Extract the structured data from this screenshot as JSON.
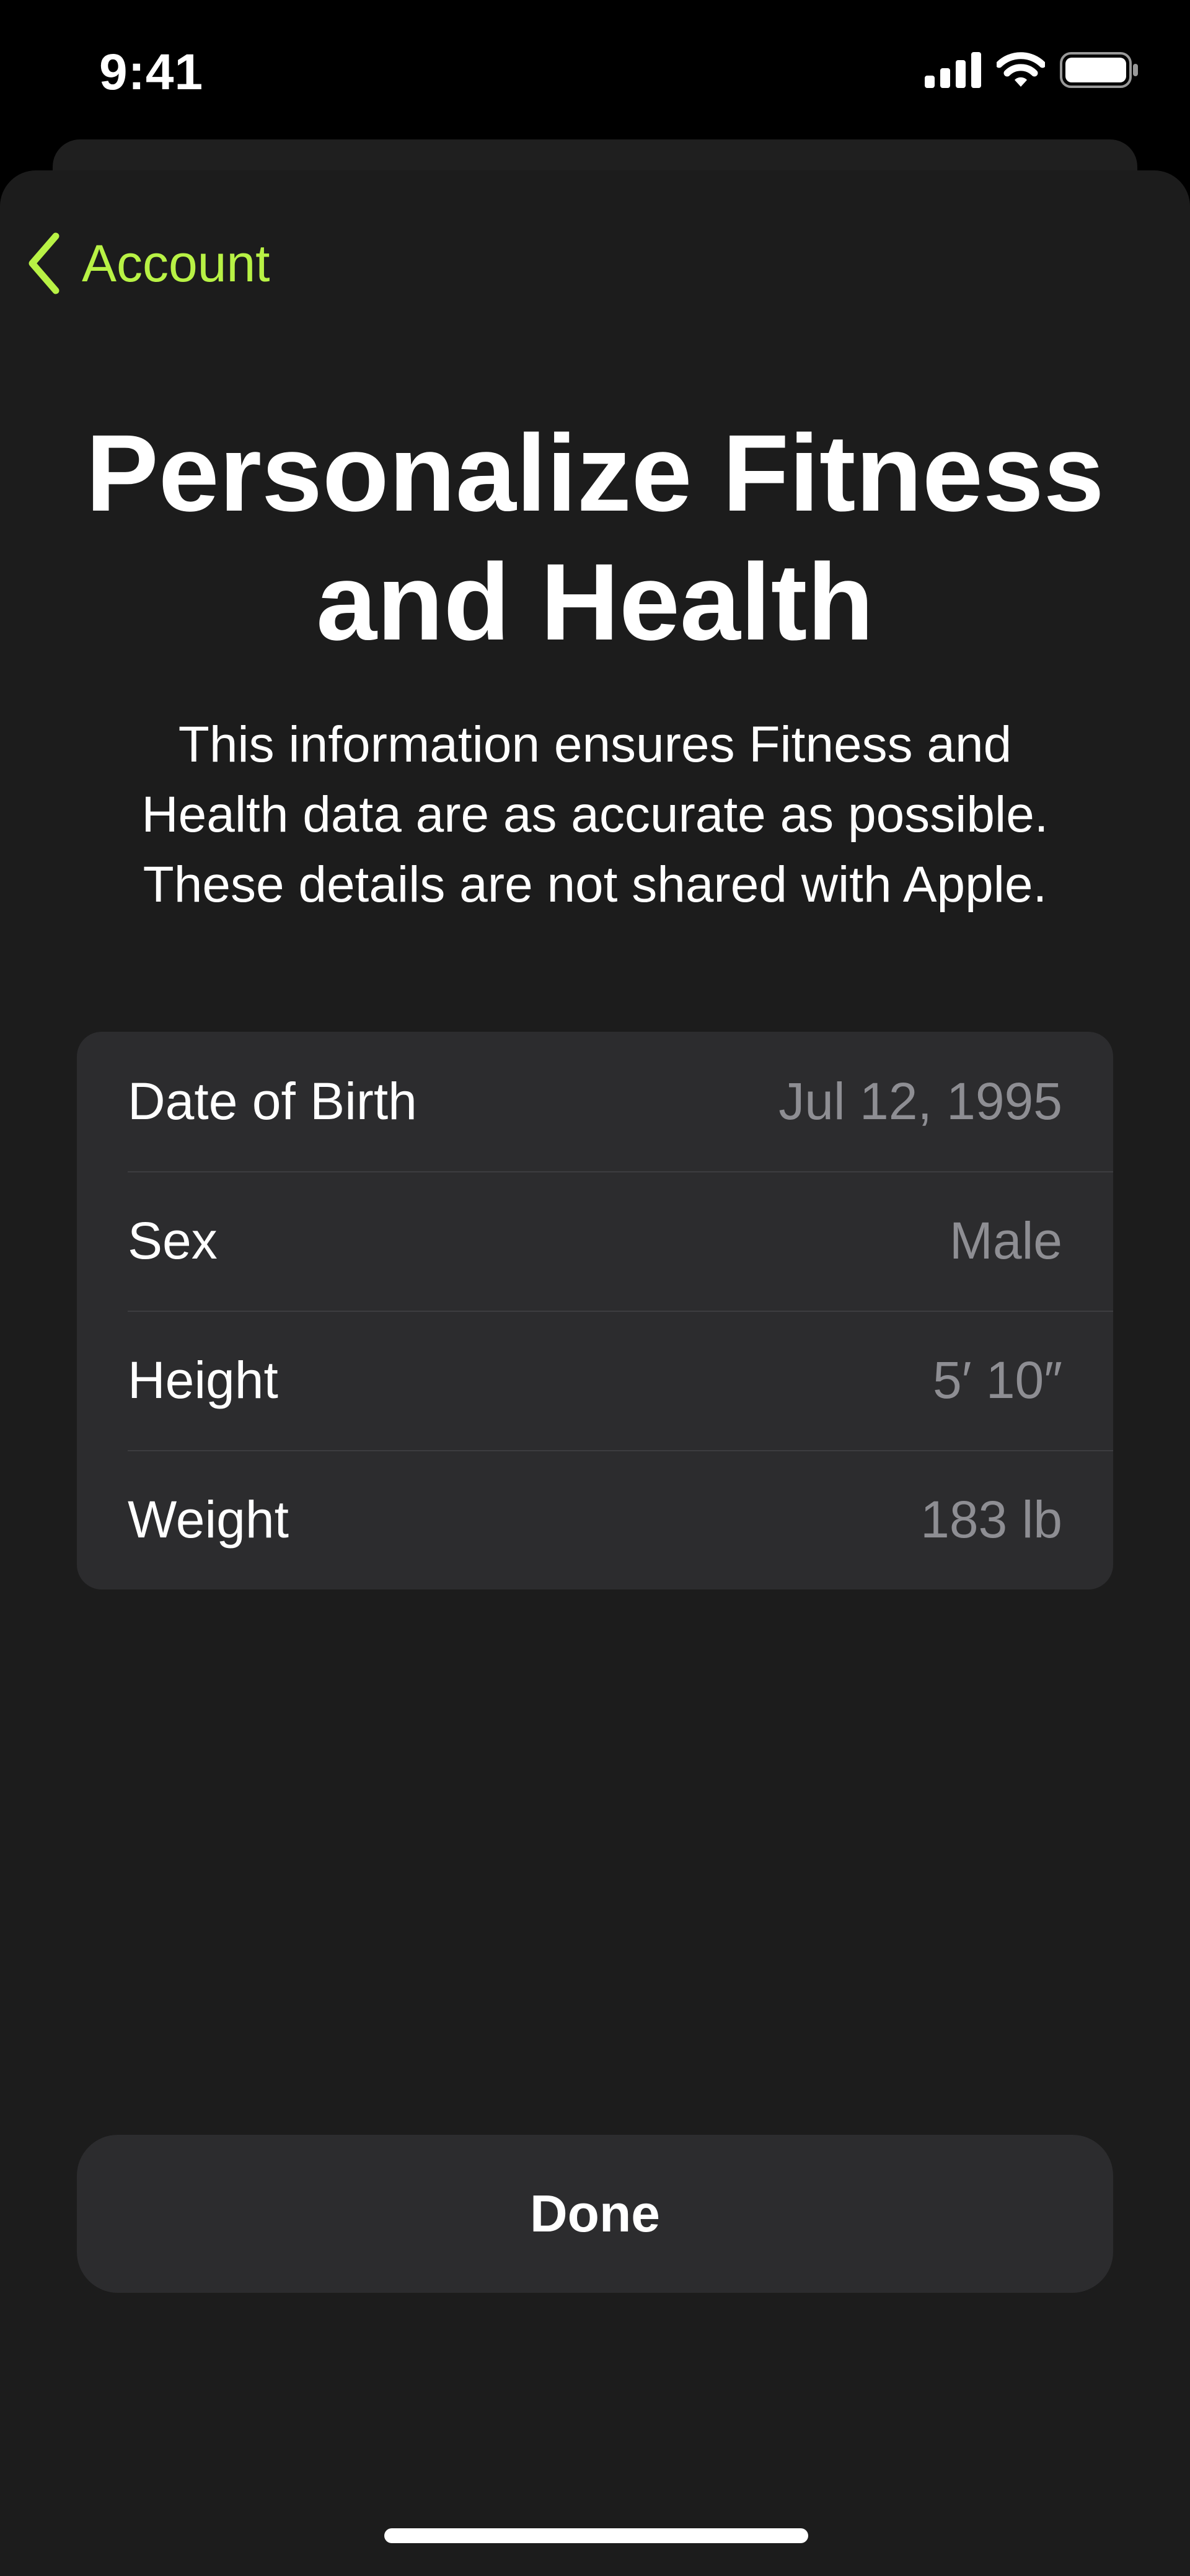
{
  "status_bar": {
    "time": "9:41",
    "icons": [
      "cellular-signal-icon",
      "wifi-icon",
      "battery-icon"
    ]
  },
  "nav": {
    "back_label": "Account",
    "back_icon": "chevron-left-icon"
  },
  "header": {
    "title_line1": "Personalize Fitness",
    "title_line2": "and Health",
    "subtitle_line1": "This information ensures Fitness and",
    "subtitle_line2": "Health data are as accurate as possible.",
    "subtitle_line3": "These details are not shared with Apple."
  },
  "details": {
    "rows": [
      {
        "label": "Date of Birth",
        "value": "Jul 12, 1995"
      },
      {
        "label": "Sex",
        "value": "Male"
      },
      {
        "label": "Height",
        "value": "5′ 10″"
      },
      {
        "label": "Weight",
        "value": "183 lb"
      }
    ]
  },
  "actions": {
    "done_label": "Done"
  },
  "colors": {
    "accent": "#b8f245",
    "background": "#1c1c1c",
    "card": "#2c2c2e",
    "secondary_text": "#8e8e93"
  }
}
